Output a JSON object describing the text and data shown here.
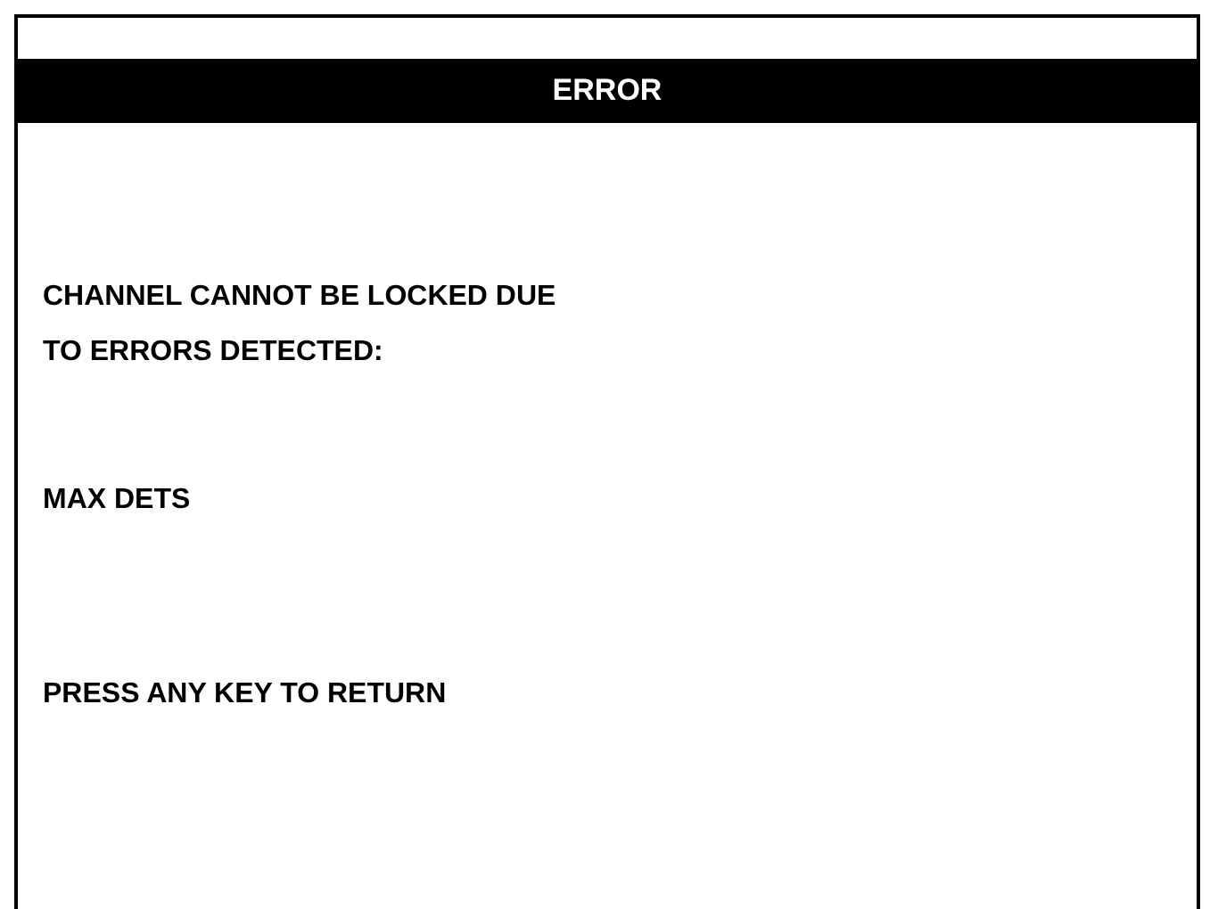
{
  "screen": {
    "title": "ERROR",
    "message_lines": [
      "CHANNEL CANNOT BE LOCKED DUE",
      "TO ERRORS DETECTED:"
    ],
    "detail": "MAX DETS",
    "prompt": "PRESS ANY KEY TO RETURN"
  }
}
